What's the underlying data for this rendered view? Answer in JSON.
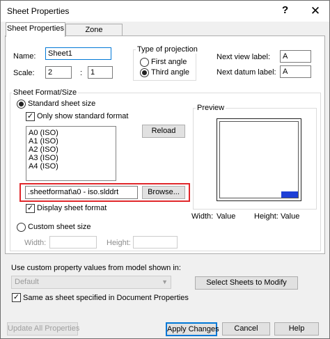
{
  "window": {
    "title": "Sheet Properties",
    "help_glyph": "?",
    "close_glyph": "✕"
  },
  "tabs": [
    {
      "label": "Sheet Properties",
      "active": true
    },
    {
      "label": "Zone Parameters",
      "active": false
    }
  ],
  "sheet": {
    "name_label": "Name:",
    "name_value": "Sheet1",
    "scale_label": "Scale:",
    "scale_numerator": "2",
    "scale_separator": ":",
    "scale_denominator": "1"
  },
  "projection": {
    "group_label": "Type of projection",
    "options": [
      {
        "label": "First angle",
        "selected": false
      },
      {
        "label": "Third angle",
        "selected": true
      }
    ]
  },
  "labels": {
    "next_view_label": "Next view label:",
    "next_view_value": "A",
    "next_datum_label": "Next datum label:",
    "next_datum_value": "A"
  },
  "format": {
    "group_label": "Sheet Format/Size",
    "standard_label": "Standard sheet size",
    "only_standard_label": "Only show standard format",
    "sizes": [
      "A0 (ISO)",
      "A1 (ISO)",
      "A2 (ISO)",
      "A3 (ISO)",
      "A4 (ISO)"
    ],
    "reload_label": "Reload",
    "format_path": ".sheetformat\\a0 - iso.slddrt",
    "browse_label": "Browse...",
    "display_format_label": "Display sheet format",
    "custom_label": "Custom sheet size",
    "width_label": "Width:",
    "height_label": "Height:"
  },
  "preview": {
    "label": "Preview",
    "width_label": "Width:",
    "width_value": "Value",
    "height_label": "Height:",
    "height_value": "Value"
  },
  "bottom": {
    "custom_property_label": "Use custom property values from model shown in:",
    "model_combo_value": "Default",
    "select_sheets_label": "Select Sheets to Modify",
    "same_as_label": "Same as sheet specified in Document Properties"
  },
  "footer": {
    "update_all_label": "Update All Properties",
    "apply_label": "Apply Changes",
    "cancel_label": "Cancel",
    "help_label": "Help"
  },
  "colors": {
    "highlight": "#e0262a",
    "focus": "#0078d7",
    "preview_title_block": "#1e3fd6"
  }
}
